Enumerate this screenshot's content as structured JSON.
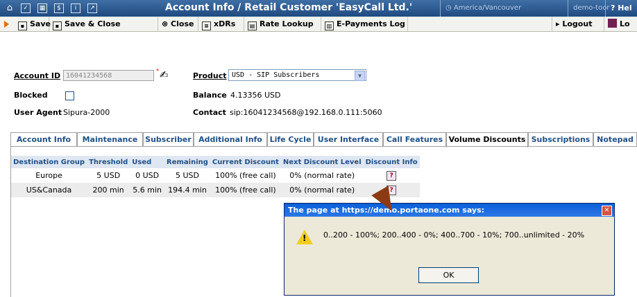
{
  "window": {
    "title": "Account Info / Retail Customer 'EasyCall Ltd.'",
    "timezone": "America/Vancouver",
    "user": "demo-toor",
    "help": "Hel"
  },
  "toolbar": {
    "save": "Save",
    "save_close": "Save & Close",
    "close": "Close",
    "xdrs": "xDRs",
    "rate_lookup": "Rate Lookup",
    "epayments": "E-Payments Log",
    "logout": "Logout",
    "log": "Lo"
  },
  "account": {
    "id_label": "Account ID",
    "id_value": "16041234568",
    "product_label": "Product",
    "product_value": "USD - SIP Subscribers",
    "blocked_label": "Blocked",
    "balance_label": "Balance",
    "balance_value": "4.13356 USD",
    "user_agent_label": "User Agent",
    "user_agent_value": "Sipura-2000",
    "contact_label": "Contact",
    "contact_value": "sip:16041234568@192.168.0.111:5060"
  },
  "tabs": [
    {
      "label": "Account Info"
    },
    {
      "label": "Maintenance"
    },
    {
      "label": "Subscriber"
    },
    {
      "label": "Additional Info"
    },
    {
      "label": "Life Cycle"
    },
    {
      "label": "User Interface"
    },
    {
      "label": "Call Features"
    },
    {
      "label": "Volume Discounts"
    },
    {
      "label": "Subscriptions"
    },
    {
      "label": "Notepad"
    }
  ],
  "table": {
    "headers": [
      "Destination Group",
      "Threshold",
      "Used",
      "Remaining",
      "Current Discount",
      "Next Discount Level",
      "Discount Info"
    ],
    "rows": [
      [
        "Europe",
        "5 USD",
        "0 USD",
        "5 USD",
        "100% (free call)",
        "0% (normal rate)"
      ],
      [
        "US&Canada",
        "200 min",
        "5.6 min",
        "194.4 min",
        "100% (free call)",
        "0% (normal rate)"
      ]
    ]
  },
  "dialog": {
    "title": "The page at https://demo.portaone.com says:",
    "message": "0..200 - 100%; 200..400 - 0%; 400..700 - 10%; 700..unlimited - 20%",
    "ok": "OK"
  }
}
